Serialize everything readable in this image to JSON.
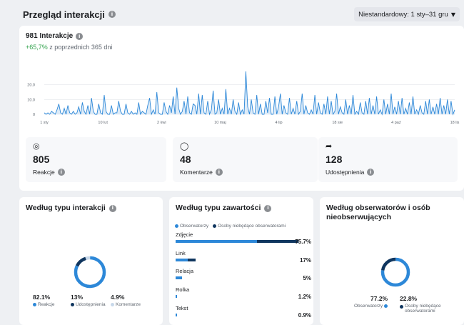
{
  "header": {
    "title": "Przegląd interakcji",
    "date_range": "Niestandardowy: 1 sty–31 gru"
  },
  "overview": {
    "total_label": "981 Interakcje",
    "change_pct": "+65,7%",
    "change_text": " z poprzednich 365 dni"
  },
  "chart_data": {
    "type": "area",
    "x_tick_labels": [
      "1 sty",
      "10 lut",
      "2 kwi",
      "10 maj",
      "4 lip",
      "18 sie",
      "4 paź",
      "18 lis"
    ],
    "y_tick_labels": [
      "20.0",
      "10.0",
      "0"
    ],
    "ylim": [
      0,
      28
    ],
    "series": [
      {
        "values": [
          1,
          0,
          1,
          0,
          2,
          1,
          0,
          3,
          7,
          1,
          0,
          4,
          0,
          6,
          1,
          0,
          2,
          0,
          1,
          5,
          0,
          8,
          2,
          0,
          6,
          0,
          11,
          2,
          0,
          0,
          7,
          1,
          0,
          13,
          2,
          0,
          0,
          6,
          0,
          1,
          1,
          9,
          2,
          0,
          0,
          7,
          1,
          0,
          2,
          0,
          1,
          0,
          8,
          0,
          2,
          1,
          0,
          6,
          11,
          0,
          3,
          0,
          15,
          1,
          0,
          0,
          8,
          2,
          0,
          6,
          1,
          12,
          0,
          18,
          4,
          0,
          2,
          9,
          0,
          12,
          1,
          0,
          7,
          6,
          0,
          14,
          0,
          13,
          1,
          0,
          9,
          0,
          3,
          16,
          0,
          1,
          10,
          0,
          4,
          0,
          17,
          0,
          4,
          0,
          10,
          2,
          0,
          8,
          0,
          3,
          0,
          29,
          5,
          0,
          10,
          1,
          0,
          13,
          0,
          7,
          0,
          0,
          9,
          1,
          11,
          0,
          0,
          12,
          0,
          5,
          14,
          0,
          6,
          1,
          0,
          11,
          0,
          4,
          0,
          9,
          0,
          2,
          14,
          0,
          6,
          1,
          0,
          3,
          0,
          13,
          0,
          8,
          1,
          0,
          7,
          0,
          12,
          0,
          9,
          0,
          2,
          14,
          0,
          5,
          1,
          0,
          10,
          0,
          6,
          0,
          13,
          0,
          2,
          0,
          8,
          1,
          0,
          9,
          0,
          11,
          0,
          6,
          0,
          12,
          0,
          3,
          0,
          10,
          0,
          7,
          0,
          14,
          0,
          5,
          0,
          9,
          0,
          11,
          0,
          4,
          0,
          8,
          0,
          12,
          0,
          3,
          0,
          6,
          1,
          0,
          9,
          0,
          10,
          0,
          5,
          0,
          7,
          0,
          11,
          0,
          6,
          0,
          10,
          0,
          9,
          0,
          3
        ]
      }
    ]
  },
  "metrics": [
    {
      "icon": "◎",
      "value": "805",
      "label": "Reakcje"
    },
    {
      "icon": "◯",
      "value": "48",
      "label": "Komentarze"
    },
    {
      "icon": "➦",
      "value": "128",
      "label": "Udostępnienia"
    }
  ],
  "by_interaction_type": {
    "title": "Według typu interakcji",
    "items": [
      {
        "pct": "82.1%",
        "label": "Reakcje",
        "color": "#2d88d8",
        "value": 82.1
      },
      {
        "pct": "13%",
        "label": "Udostępnienia",
        "color": "#10365f",
        "value": 13
      },
      {
        "pct": "4.9%",
        "label": "Komentarze",
        "color": "#c7d8ea",
        "value": 4.9
      }
    ]
  },
  "by_content_type": {
    "title": "Według typu zawartości",
    "legend": [
      {
        "label": "Obserwatorzy",
        "color": "#2d88d8"
      },
      {
        "label": "Osoby niebędące obserwatorami",
        "color": "#10365f"
      }
    ],
    "rows": [
      {
        "label": "Zdjęcie",
        "pct": "75.7%",
        "followers": 0.66,
        "non_followers": 0.34
      },
      {
        "label": "Link",
        "pct": "17%",
        "followers": 0.1,
        "non_followers": 0.06
      },
      {
        "label": "Relacja",
        "pct": "5%",
        "followers": 0.05,
        "non_followers": 0.0
      },
      {
        "label": "Rolka",
        "pct": "1.2%",
        "followers": 0.01,
        "non_followers": 0.0
      },
      {
        "label": "Tekst",
        "pct": "0.9%",
        "followers": 0.008,
        "non_followers": 0.0
      }
    ]
  },
  "by_followers": {
    "title": "Według obserwatorów i osób nieobserwujących",
    "items": [
      {
        "pct": "77.2%",
        "label": "Obserwatorzy",
        "color": "#2d88d8",
        "value": 77.2
      },
      {
        "pct": "22.8%",
        "label": "Osoby niebędące obserwatorami",
        "color": "#10365f",
        "value": 22.8
      }
    ]
  }
}
